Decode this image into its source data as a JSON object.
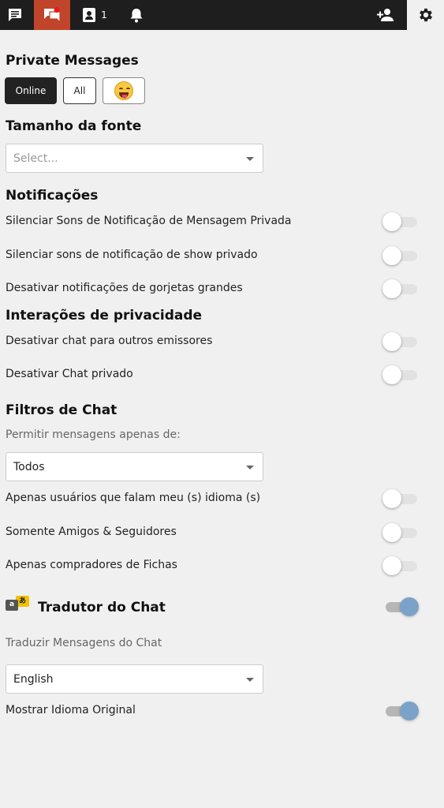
{
  "topbar": {
    "tabs": [
      {
        "name": "chat-tab",
        "icon": "chat-icon"
      },
      {
        "name": "private-messages-tab",
        "icon": "private-messages-icon",
        "active": true
      },
      {
        "name": "users-tab",
        "icon": "contact-card-icon",
        "count": "1"
      },
      {
        "name": "notifications-tab",
        "icon": "bell-icon"
      },
      {
        "name": "add-friend-tab",
        "icon": "add-person-icon"
      },
      {
        "name": "settings-tab",
        "icon": "gear-icon",
        "selected": true
      }
    ],
    "accent_color": "#c0452a",
    "bar_color": "#1e1e1e"
  },
  "private_messages": {
    "title": "Private Messages",
    "filters": [
      {
        "label": "Online",
        "selected": true
      },
      {
        "label": "All",
        "selected": false
      },
      {
        "label": "",
        "icon": "squinting-tongue-emoji-icon",
        "selected": false
      }
    ]
  },
  "font_size": {
    "title": "Tamanho da fonte",
    "select_placeholder": "Select..."
  },
  "notifications": {
    "title": "Notificações",
    "items": [
      {
        "label": "Silenciar Sons de Notificação de Mensagem Privada",
        "on": false
      },
      {
        "label": "Silenciar sons de notificação de show privado",
        "on": false
      },
      {
        "label": "Desativar notificações de gorjetas grandes",
        "on": false
      }
    ]
  },
  "privacy": {
    "title": "Interações de privacidade",
    "items": [
      {
        "label": "Desativar chat para outros emissores",
        "on": false
      },
      {
        "label": "Desativar Chat privado",
        "on": false
      }
    ]
  },
  "chat_filters": {
    "title": "Filtros de Chat",
    "allow_label": "Permitir mensagens apenas de:",
    "allow_value": "Todos",
    "items": [
      {
        "label": "Apenas usuários que falam meu (s) idioma (s)",
        "on": false
      },
      {
        "label": "Somente Amigos & Seguidores",
        "on": false
      },
      {
        "label": "Apenas compradores de Fichas",
        "on": false
      }
    ]
  },
  "translator": {
    "title": "Tradutor do Chat",
    "icon": "translate-icon",
    "icon_glyph_a": "a",
    "icon_glyph_b": "あ",
    "on": true,
    "translate_label": "Traduzir Mensagens do Chat",
    "language": "English",
    "show_original_label": "Mostrar Idioma Original",
    "show_original_on": true,
    "toggle_on_color": "#7ba2c8"
  }
}
